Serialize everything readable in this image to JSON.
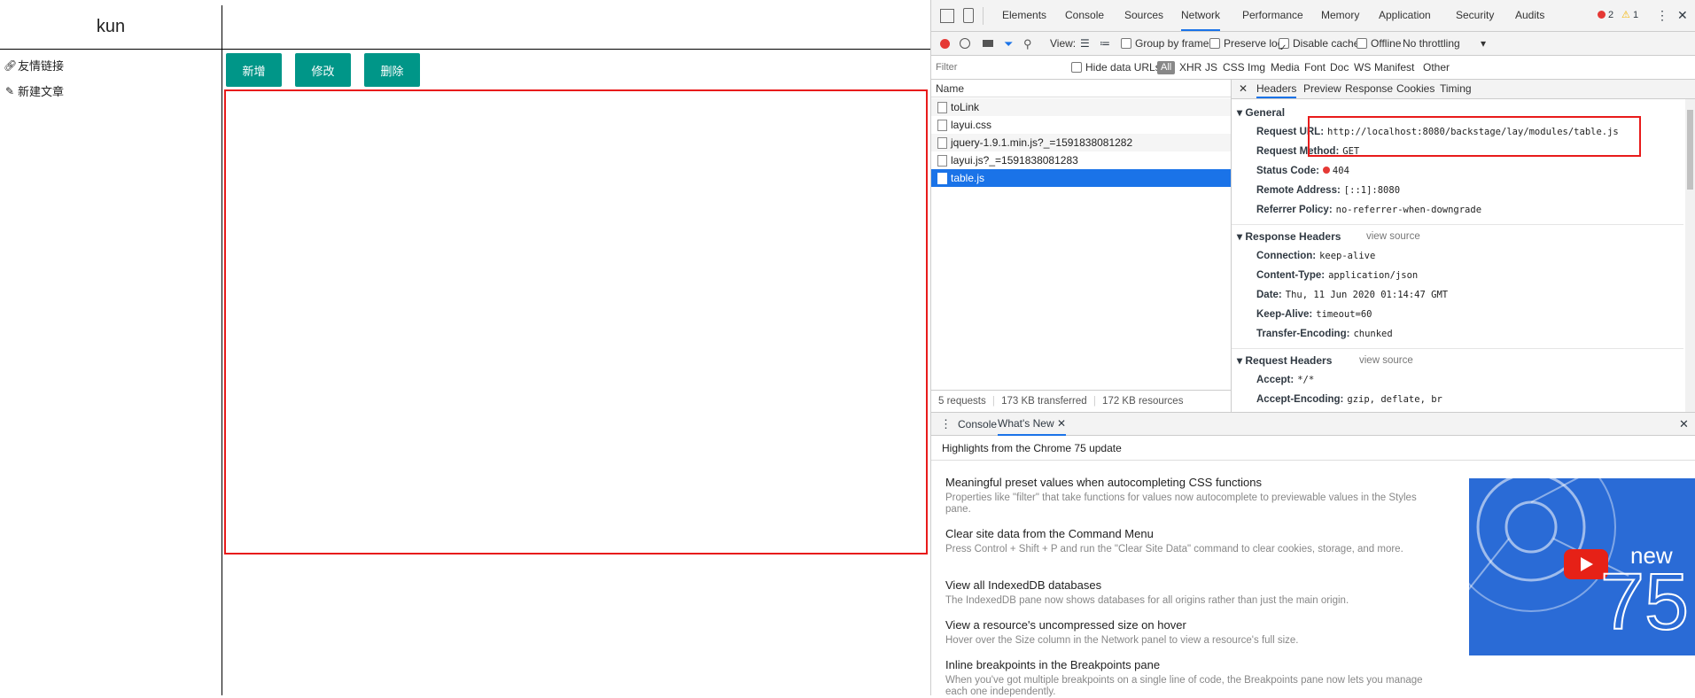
{
  "page": {
    "logo": "kun",
    "sidebar": [
      {
        "icon": "link-icon",
        "label": "友情链接"
      },
      {
        "icon": "pencil-icon",
        "label": "新建文章"
      }
    ],
    "buttons": {
      "add": "新增",
      "edit": "修改",
      "delete": "删除"
    }
  },
  "devtools": {
    "tabs": [
      "Elements",
      "Console",
      "Sources",
      "Network",
      "Performance",
      "Memory",
      "Application",
      "Security",
      "Audits"
    ],
    "active_tab": "Network",
    "errors": "2",
    "warnings": "1",
    "toolbar": {
      "view_label": "View:",
      "group_by_frame": "Group by frame",
      "preserve_log": "Preserve log",
      "disable_cache": "Disable cache",
      "offline": "Offline",
      "throttling": "No throttling"
    },
    "filter": {
      "placeholder": "Filter",
      "hide_data_urls": "Hide data URLs",
      "types": [
        "All",
        "XHR",
        "JS",
        "CSS",
        "Img",
        "Media",
        "Font",
        "Doc",
        "WS",
        "Manifest",
        "Other"
      ]
    },
    "name_header": "Name",
    "requests": [
      "toLink",
      "layui.css",
      "jquery-1.9.1.min.js?_=1591838081282",
      "layui.js?_=1591838081283",
      "table.js"
    ],
    "selected_request": "table.js",
    "status_bar": {
      "requests": "5 requests",
      "transferred": "173 KB transferred",
      "resources": "172 KB resources"
    },
    "detail_tabs": [
      "Headers",
      "Preview",
      "Response",
      "Cookies",
      "Timing"
    ],
    "general": {
      "title": "General",
      "rows": [
        {
          "k": "Request URL:",
          "v": "http://localhost:8080/backstage/lay/modules/table.js"
        },
        {
          "k": "Request Method:",
          "v": "GET"
        },
        {
          "k": "Status Code:",
          "v": "404"
        },
        {
          "k": "Remote Address:",
          "v": "[::1]:8080"
        },
        {
          "k": "Referrer Policy:",
          "v": "no-referrer-when-downgrade"
        }
      ]
    },
    "response_headers": {
      "title": "Response Headers",
      "view_source": "view source",
      "rows": [
        {
          "k": "Connection:",
          "v": "keep-alive"
        },
        {
          "k": "Content-Type:",
          "v": "application/json"
        },
        {
          "k": "Date:",
          "v": "Thu, 11 Jun 2020 01:14:47 GMT"
        },
        {
          "k": "Keep-Alive:",
          "v": "timeout=60"
        },
        {
          "k": "Transfer-Encoding:",
          "v": "chunked"
        }
      ]
    },
    "request_headers": {
      "title": "Request Headers",
      "view_source": "view source",
      "rows": [
        {
          "k": "Accept:",
          "v": "*/*"
        },
        {
          "k": "Accept-Encoding:",
          "v": "gzip, deflate, br"
        }
      ]
    },
    "drawer": {
      "tabs": [
        "Console",
        "What's New"
      ],
      "highlights": "Highlights from the Chrome 75 update",
      "items": [
        {
          "title": "Meaningful preset values when autocompleting CSS functions",
          "desc": "Properties like \"filter\" that take functions for values now autocomplete to previewable values in the Styles pane."
        },
        {
          "title": "Clear site data from the Command Menu",
          "desc": "Press Control + Shift + P and run the \"Clear Site Data\" command to clear cookies, storage, and more."
        },
        {
          "title": "View all IndexedDB databases",
          "desc": "The IndexedDB pane now shows databases for all origins rather than just the main origin."
        },
        {
          "title": "View a resource's uncompressed size on hover",
          "desc": "Hover over the Size column in the Network panel to view a resource's full size."
        },
        {
          "title": "Inline breakpoints in the Breakpoints pane",
          "desc": "When you've got multiple breakpoints on a single line of code, the Breakpoints pane now lets you manage each one independently."
        }
      ],
      "promo": {
        "label": "new",
        "version": "75"
      }
    },
    "colors": {
      "accent": "#1a73e8",
      "button": "#009688",
      "highlight_box": "#e81b1b",
      "promo_bg": "#2a6bd6"
    }
  }
}
